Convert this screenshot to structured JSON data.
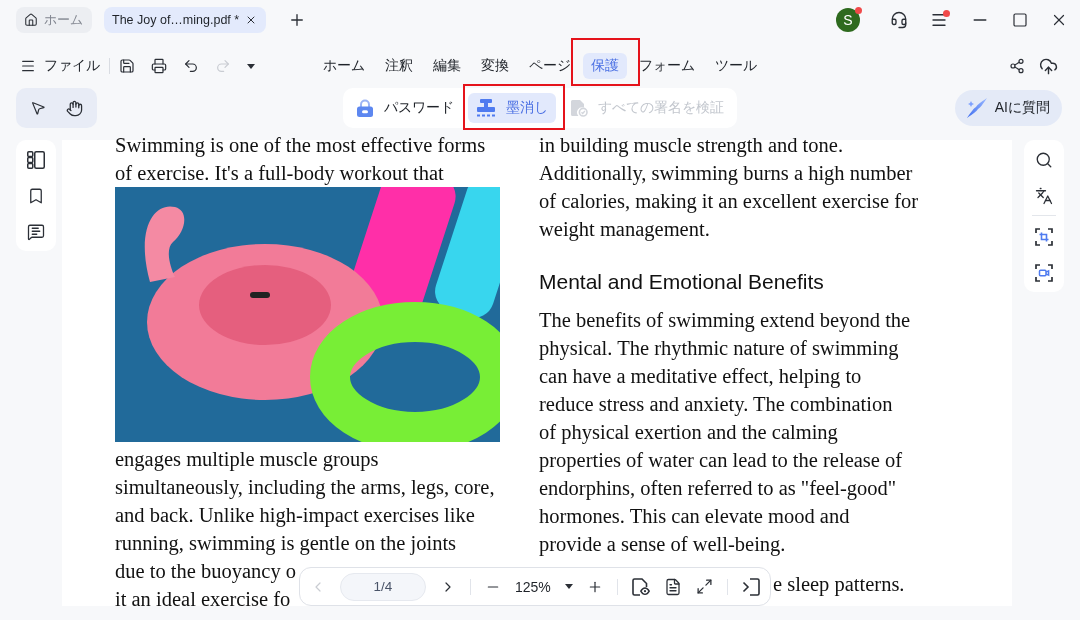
{
  "title_bar": {
    "tabs": [
      {
        "kind": "home",
        "label": "ホーム",
        "selected": false
      },
      {
        "kind": "document",
        "label": "The Joy of…ming.pdf *",
        "selected": true
      }
    ],
    "account": {
      "initial": "S",
      "notification": true
    },
    "menu": {
      "notification": true
    }
  },
  "ribbon": {
    "file_label": "ファイル",
    "quick_actions": [
      {
        "kind": "save",
        "disabled": false
      },
      {
        "kind": "print",
        "disabled": false
      },
      {
        "kind": "undo",
        "disabled": false
      },
      {
        "kind": "redo",
        "disabled": true
      },
      {
        "kind": "more",
        "disabled": false
      }
    ],
    "tabs": [
      {
        "label": "ホーム",
        "selected": false,
        "highlighted": false
      },
      {
        "label": "注釈",
        "selected": false,
        "highlighted": false
      },
      {
        "label": "編集",
        "selected": false,
        "highlighted": false
      },
      {
        "label": "変換",
        "selected": false,
        "highlighted": false
      },
      {
        "label": "ページ",
        "selected": false,
        "highlighted": false
      },
      {
        "label": "保護",
        "selected": true,
        "highlighted": true
      },
      {
        "label": "フォーム",
        "selected": false,
        "highlighted": false
      },
      {
        "label": "ツール",
        "selected": false,
        "highlighted": false
      }
    ]
  },
  "protect_tools": [
    {
      "kind": "password",
      "label": "パスワード",
      "selected": false,
      "disabled": false,
      "highlighted": false
    },
    {
      "kind": "redact",
      "label": "墨消し",
      "selected": true,
      "disabled": false,
      "highlighted": true
    },
    {
      "kind": "verify",
      "label": "すべての署名を検証",
      "selected": false,
      "disabled": true,
      "highlighted": false
    }
  ],
  "ai_button": {
    "label": "AIに質問"
  },
  "document": {
    "columns": [
      {
        "blocks": [
          {
            "kind": "paragraph",
            "lines": [
              "Swimming is one of the most effective forms",
              "of exercise. It's a full-body workout that"
            ]
          },
          {
            "kind": "photo"
          },
          {
            "kind": "paragraph",
            "lines": [
              "engages multiple muscle groups",
              "simultaneously, including the arms, legs, core,",
              "and back. Unlike high-impact exercises like",
              "running, swimming is gentle on the joints"
            ]
          },
          {
            "kind": "paragraph",
            "lines": [
              "due to the buoyancy o",
              "it an ideal exercise fo"
            ]
          }
        ]
      },
      {
        "blocks": [
          {
            "kind": "paragraph",
            "lines": [
              "in building muscle strength and tone.",
              "Additionally, swimming burns a high number",
              "of calories, making it an excellent exercise for",
              "weight management."
            ]
          },
          {
            "kind": "heading",
            "text": "Mental and Emotional Benefits"
          },
          {
            "kind": "paragraph",
            "lines": [
              "The benefits of swimming extend beyond the",
              "physical. The rhythmic nature of swimming",
              "can have a meditative effect, helping to",
              "reduce stress and anxiety. The combination",
              "of physical exertion and the calming",
              "properties of water can lead to the release of",
              "endorphins, often referred to as \"feel-good\"",
              "hormones. This can elevate mood and",
              "provide a sense of well-being."
            ]
          },
          {
            "kind": "fragment",
            "text": "e sleep patterns."
          }
        ]
      }
    ]
  },
  "page_nav": {
    "page": "1/4",
    "zoom": "125%",
    "prev_disabled": true,
    "next_disabled": false
  }
}
